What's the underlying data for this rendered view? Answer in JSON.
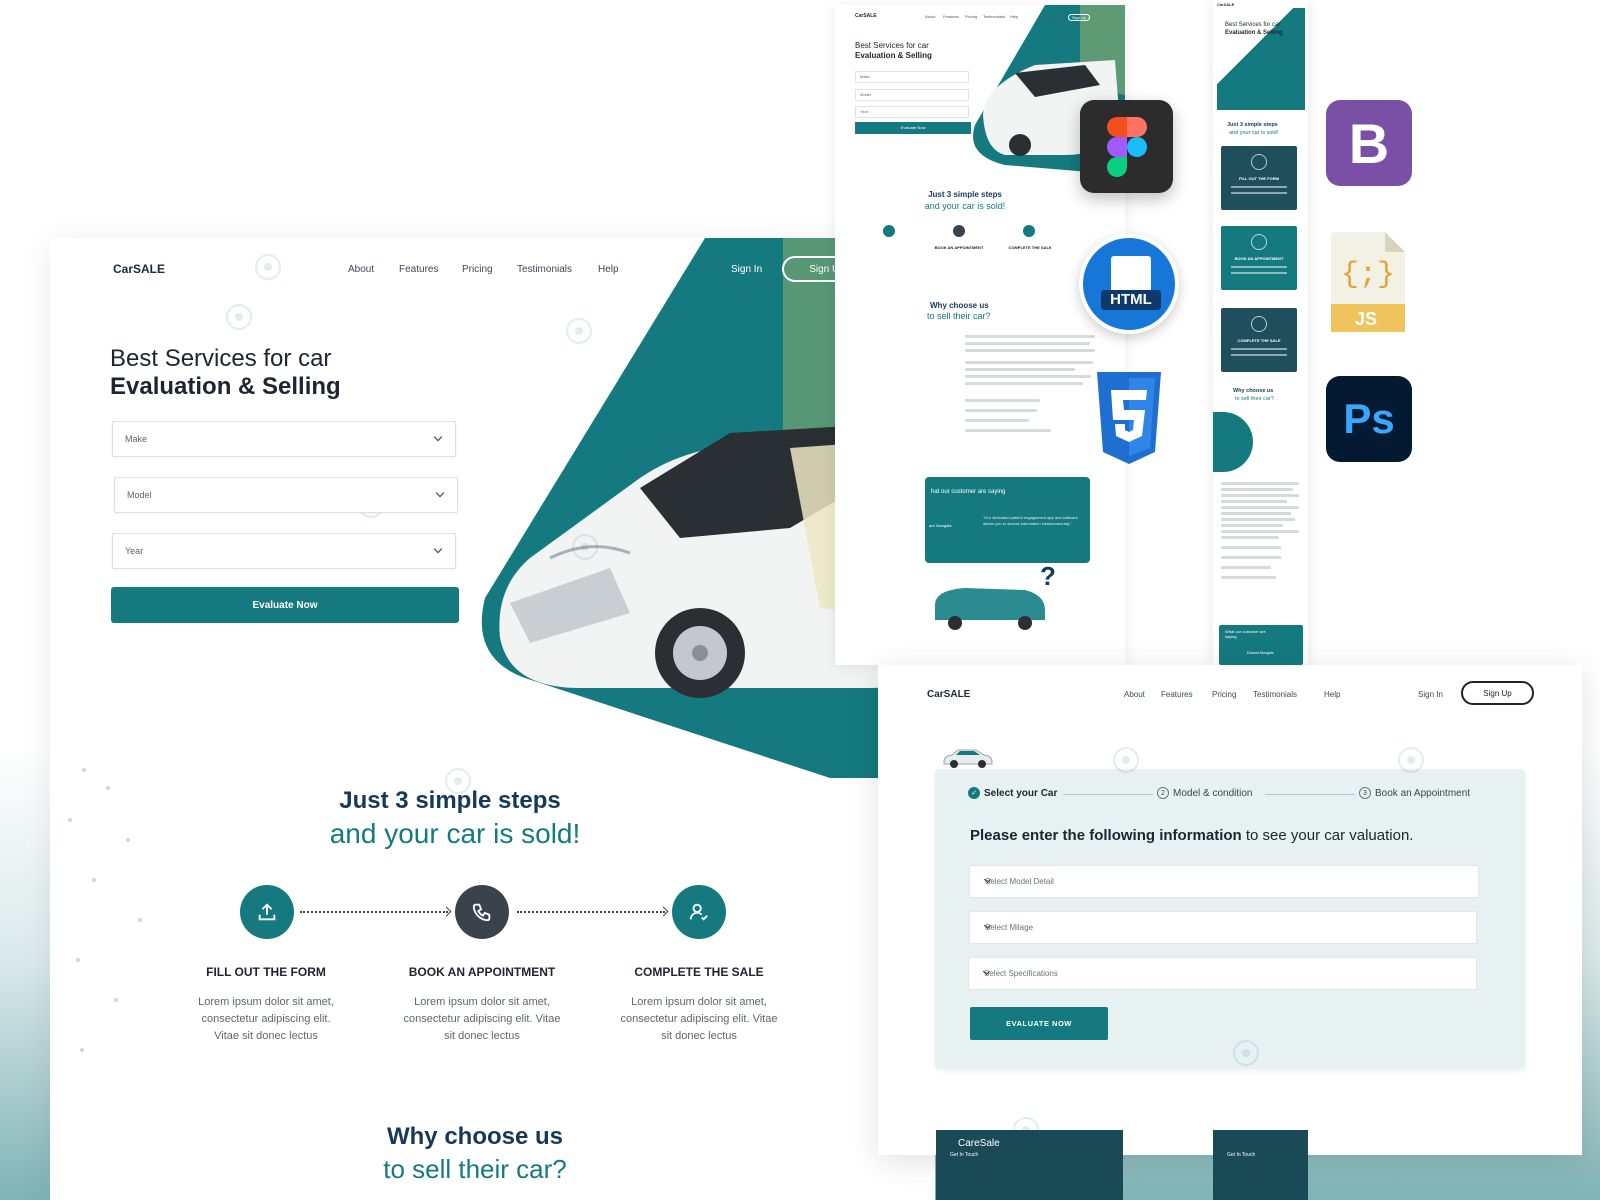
{
  "main": {
    "logo": "CarSALE",
    "nav": [
      "About",
      "Features",
      "Pricing",
      "Testimonials",
      "Help"
    ],
    "sign_in": "Sign In",
    "sign_up": "Sign Up",
    "hero_line1": "Best Services for car",
    "hero_line2": "Evaluation & Selling",
    "selects": [
      "Make",
      "Model",
      "Year"
    ],
    "evaluate": "Evaluate Now",
    "steps_title1": "Just 3 simple steps",
    "steps_title2": "and your car is sold!",
    "steps": [
      {
        "name": "FILL OUT THE FORM",
        "desc1": "Lorem ipsum dolor sit amet,",
        "desc2": "consectetur adipiscing elit.",
        "desc3": "Vitae sit donec lectus",
        "icon": "upload-icon"
      },
      {
        "name": "BOOK AN APPOINTMENT",
        "desc1": "Lorem ipsum dolor sit amet,",
        "desc2": "consectetur adipiscing elit. Vitae",
        "desc3": "sit donec lectus",
        "icon": "phone-icon"
      },
      {
        "name": "COMPLETE THE SALE",
        "desc1": "Lorem ipsum dolor sit amet,",
        "desc2": "consectetur adipiscing elit. Vitae",
        "desc3": "sit donec lectus",
        "icon": "user-check-icon"
      }
    ],
    "why1": "Why choose us",
    "why2": "to sell their car?"
  },
  "mini": {
    "logo": "CarSALE",
    "nav": [
      "About",
      "Features",
      "Pricing",
      "Testimonials",
      "Help"
    ],
    "sign_in": "Sign In",
    "sign_up": "Sign Up",
    "title1": "Best Services for car",
    "title2": "Evaluation & Selling",
    "selects": [
      "Make",
      "Model",
      "Year"
    ],
    "evaluate": "Evaluate Now",
    "sub1": "Just 3 simple steps",
    "sub2": "and your car is sold!",
    "steps": [
      "BOOK AN APPOINTMENT",
      "COMPLETE THE SALE"
    ],
    "why1": "Why choose us",
    "why2": "to sell their car?",
    "testimonial_title": "hat our customer are saying",
    "testimonial_quote": "\"Our dedicated patient engagement app and software allows you to access information instantaneously.\"",
    "testimonial_name": "ard Nowgate"
  },
  "phone": {
    "logo": "CarSALE",
    "title1": "Best Services for car",
    "title2": "Evaluation & Selling",
    "sub1": "Just 3 simple steps",
    "sub2": "and your car is sold!",
    "cards": [
      "FILL OUT THE FORM",
      "BOOK AN APPOINTMENT",
      "COMPLETE THE SALE"
    ],
    "why1": "Why choose us",
    "why2": "to sell their car?",
    "testimonial_title": "What our customer are saying",
    "testimonial_name": "Edward Nowgate"
  },
  "tools": {
    "bootstrap": "B",
    "html": "HTML",
    "js": "JS",
    "ps": "Ps"
  },
  "form": {
    "logo": "CarSALE",
    "nav": [
      "About",
      "Features",
      "Pricing",
      "Testimonials",
      "Help"
    ],
    "sign_in": "Sign In",
    "sign_up": "Sign Up",
    "wizard": [
      {
        "num": "✓",
        "label": "Select your Car"
      },
      {
        "num": "2",
        "label": "Model & condition"
      },
      {
        "num": "3",
        "label": "Book an Appointment"
      }
    ],
    "heading_bold": "Please enter the following information",
    "heading_rest": " to see your car valuation.",
    "inputs": [
      "Select Model Detail",
      "Select Milage",
      "Select Specifications"
    ],
    "button": "EVALUATE NOW"
  },
  "footer": {
    "brand": "CareSale",
    "get_in_touch": "Get In Touch"
  },
  "colors": {
    "teal": "#157a80",
    "navy": "#16395a",
    "sage": "#5e9a74",
    "cream": "#ece6c2"
  }
}
